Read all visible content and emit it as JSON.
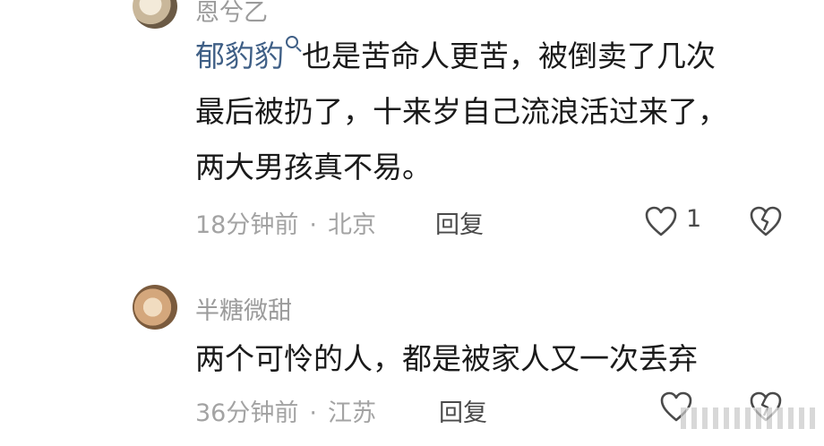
{
  "comments": [
    {
      "username": "恩兮乙",
      "mention": "郁豹豹",
      "text_line1": "也是苦命人更苦，被倒卖了几次",
      "text_line2": "最后被扔了，十来岁自己流浪活过来了，",
      "text_line3": "两大男孩真不易。",
      "time": "18分钟前",
      "location": "北京",
      "reply_label": "回复",
      "like_count": "1",
      "like_icon": "heart-outline-icon",
      "dislike_icon": "broken-heart-icon"
    },
    {
      "username": "半糖微甜",
      "text": "两个可怜的人，都是被家人又一次丢弃",
      "time": "36分钟前",
      "location": "江苏",
      "reply_label": "回复",
      "like_icon": "heart-outline-icon",
      "dislike_icon": "broken-heart-icon"
    }
  ],
  "separator": "·",
  "colors": {
    "mention": "#3f5f86",
    "meta": "#a3a3a3",
    "username": "#9b9b9b",
    "text": "#1a1a1a"
  }
}
